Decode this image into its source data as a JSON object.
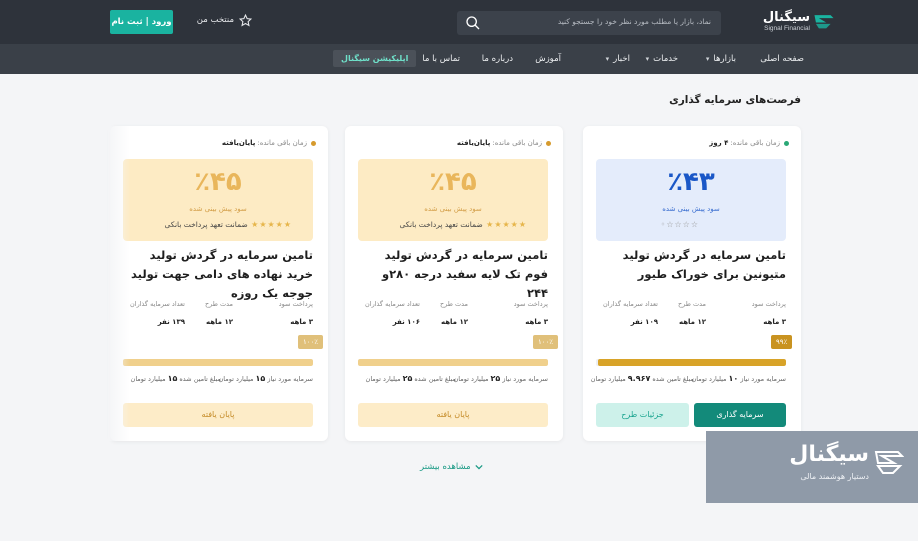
{
  "header": {
    "brand_name": "سیگنال",
    "brand_sub": "Signal Financial",
    "search_placeholder": "نماد، بازار یا مطلب مورد نظر خود را جستجو کنید",
    "favorites_label": "منتخب من",
    "login_label": "ورود | ثبت نام"
  },
  "nav": {
    "items": [
      {
        "label": "صفحه اصلی",
        "dropdown": false
      },
      {
        "label": "بازارها",
        "dropdown": true
      },
      {
        "label": "خدمات",
        "dropdown": true
      },
      {
        "label": "اخبار",
        "dropdown": true
      },
      {
        "label": "آموزش",
        "dropdown": false
      },
      {
        "label": "درباره ما",
        "dropdown": false
      },
      {
        "label": "تماس با ما",
        "dropdown": false
      }
    ],
    "app_label": "اپلیکیشن سیگنال",
    "chevron_glyph": "⌄"
  },
  "section_title": "فرصت‌های سرمایه گذاری",
  "cards": [
    {
      "remaining_label": "زمان باقی مانده:",
      "remaining_value": "۴ روز",
      "status_color": "#2aa876",
      "profit_pct": "٪۴۳",
      "profit_label": "سود پیش بینی شده",
      "stars": 0,
      "guarantee_label": "",
      "title": "تامین سرمایه در گردش تولید متیونین برای خوراک طیور",
      "stats": [
        {
          "k": "پرداخت سود",
          "v": "۳ ماهه"
        },
        {
          "k": "مدت طرح",
          "v": "۱۲ ماهه"
        },
        {
          "k": "تعداد سرمایه گذاران",
          "v": "۱۰۹ نفر"
        }
      ],
      "progress_label": "۹۹٪",
      "progress": 0.99,
      "amount_required_label": "سرمایه مورد نیاز",
      "amount_required": "۱۰",
      "amount_required_unit": "میلیارد تومان",
      "amount_raised_label": "مبلغ تامین شده",
      "amount_raised": "۹.۹۶۷",
      "amount_raised_unit": "میلیارد تومان",
      "primary_button": "سرمایه گذاری",
      "secondary_button": "جزئیات طرح"
    },
    {
      "remaining_label": "زمان باقی مانده:",
      "remaining_value": "پایان‌یافته",
      "status_color": "#d69a2d",
      "profit_pct": "٪۴۵",
      "profit_label": "سود پیش بینی شده",
      "stars": 5,
      "guarantee_label": "ضمانت تعهد پرداخت بانکی",
      "title": "تامین سرمایه در گردش تولید فوم تک لایه سفید درجه ۲۸۰و ۲۴۴",
      "stats": [
        {
          "k": "پرداخت سود",
          "v": "۳ ماهه"
        },
        {
          "k": "مدت طرح",
          "v": "۱۲ ماهه"
        },
        {
          "k": "تعداد سرمایه گذاران",
          "v": "۱۰۶ نفر"
        }
      ],
      "progress_label": "۱۰۰٪",
      "progress": 1.0,
      "amount_required_label": "سرمایه مورد نیاز",
      "amount_required": "۲۵",
      "amount_required_unit": "میلیارد تومان",
      "amount_raised_label": "مبلغ تامین شده",
      "amount_raised": "۲۵",
      "amount_raised_unit": "میلیارد تومان",
      "primary_button": "پایان یافته"
    },
    {
      "remaining_label": "زمان باقی مانده:",
      "remaining_value": "پایان‌یافته",
      "status_color": "#d69a2d",
      "profit_pct": "٪۴۵",
      "profit_label": "سود پیش بینی شده",
      "stars": 5,
      "guarantee_label": "ضمانت تعهد پرداخت بانکی",
      "title": "تامین سرمایه در گردش تولید خرید نهاده های دامی جهت تولید جوجه یک روزه",
      "stats": [
        {
          "k": "پرداخت سود",
          "v": "۳ ماهه"
        },
        {
          "k": "مدت طرح",
          "v": "۱۲ ماهه"
        },
        {
          "k": "تعداد سرمایه گذاران",
          "v": "۱۳۹ نفر"
        }
      ],
      "progress_label": "۱۰۰٪",
      "progress": 1.0,
      "amount_required_label": "سرمایه مورد نیاز",
      "amount_required": "۱۵",
      "amount_required_unit": "میلیارد تومان",
      "amount_raised_label": "مبلغ تامین شده",
      "amount_raised": "۱۵",
      "amount_raised_unit": "میلیارد تومان",
      "primary_button": "پایان یافته"
    }
  ],
  "more_label": "مشاهده بیشتر",
  "badge": {
    "title": "سیگنال",
    "subtitle": "دستیار هوشمند مالی"
  },
  "colors": {
    "header_bg": "#2e333b",
    "nav_bg": "#3a4048",
    "accent_teal": "#1ab3a0",
    "gold": "#d8a328"
  }
}
